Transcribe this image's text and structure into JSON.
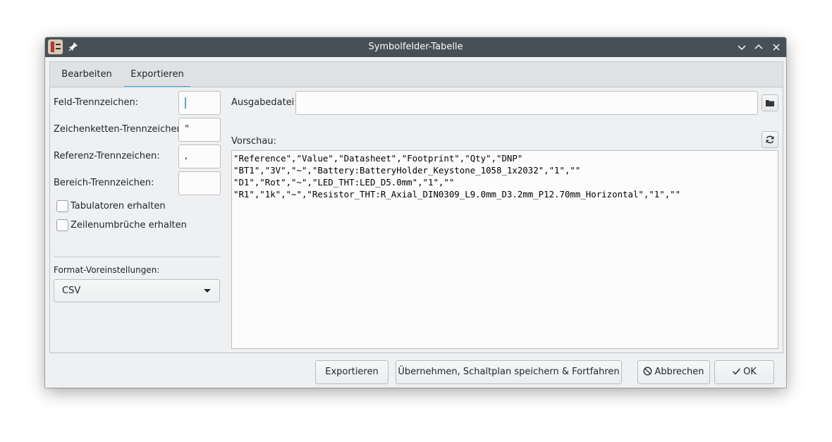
{
  "window": {
    "title": "Symbolfelder-Tabelle"
  },
  "tabs": [
    {
      "label": "Bearbeiten"
    },
    {
      "label": "Exportieren"
    }
  ],
  "left": {
    "field_delimiter_label": "Feld-Trennzeichen:",
    "field_delimiter_value": "",
    "string_delimiter_label": "Zeichenketten-Trennzeichen:",
    "string_delimiter_value": "\"",
    "ref_delimiter_label": "Referenz-Trennzeichen:",
    "ref_delimiter_value": ",",
    "range_delimiter_label": "Bereich-Trennzeichen:",
    "range_delimiter_value": "",
    "keep_tabs_label": "Tabulatoren erhalten",
    "keep_linebreaks_label": "Zeilenumbrüche erhalten",
    "format_presets_label": "Format-Voreinstellungen:",
    "format_presets_value": "CSV"
  },
  "right": {
    "output_file_label": "Ausgabedatei:",
    "output_file_value": "",
    "preview_label": "Vorschau:",
    "preview_lines": [
      "\"Reference\",\"Value\",\"Datasheet\",\"Footprint\",\"Qty\",\"DNP\"",
      "\"BT1\",\"3V\",\"~\",\"Battery:BatteryHolder_Keystone_1058_1x2032\",\"1\",\"\"",
      "\"D1\",\"Rot\",\"~\",\"LED_THT:LED_D5.0mm\",\"1\",\"\"",
      "\"R1\",\"1k\",\"~\",\"Resistor_THT:R_Axial_DIN0309_L9.0mm_D3.2mm_P12.70mm_Horizontal\",\"1\",\"\""
    ]
  },
  "buttons": {
    "export": "Exportieren",
    "apply_save_continue": "Übernehmen, Schaltplan speichern & Fortfahren",
    "cancel": "Abbrechen",
    "ok": "OK"
  },
  "icons": {
    "app": "kicad-app-icon",
    "pin": "pin-icon",
    "minimize": "chevron-down-icon",
    "maximize": "chevron-up-icon",
    "close": "close-icon",
    "folder": "folder-icon",
    "refresh": "refresh-icon",
    "cancel": "cancel-icon",
    "ok": "check-icon"
  },
  "colors": {
    "accent": "#3daee9",
    "titlebar": "#475057"
  }
}
